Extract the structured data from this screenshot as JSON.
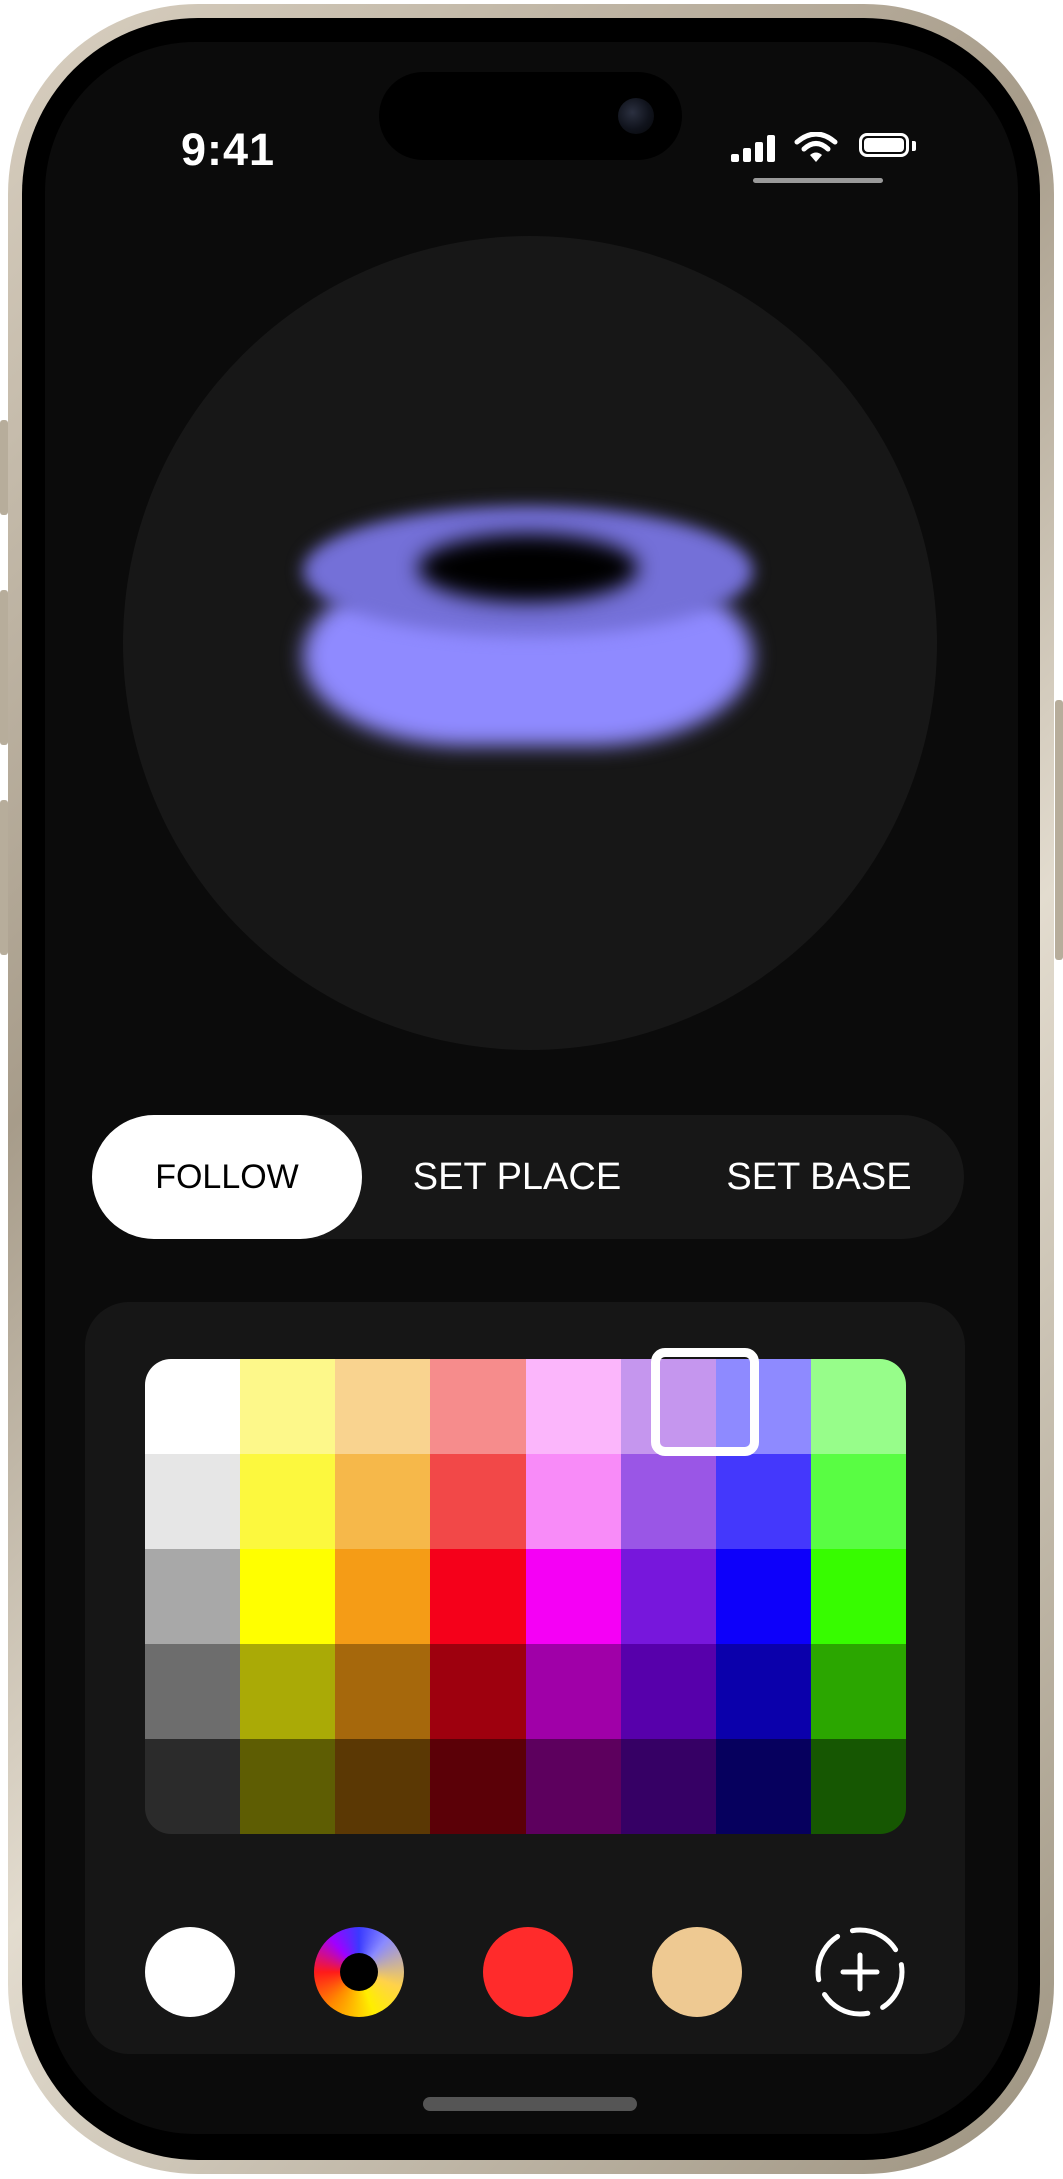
{
  "status_bar": {
    "time": "9:41"
  },
  "modes": {
    "items": [
      {
        "label": "FOLLOW",
        "active": true
      },
      {
        "label": "SET PLACE",
        "active": false
      },
      {
        "label": "SET BASE",
        "active": false
      }
    ]
  },
  "preview": {
    "ring_color": "#8f8aff"
  },
  "palette": {
    "selected": {
      "row": 0,
      "col": 6,
      "color": "#8e8aff"
    },
    "rows": [
      [
        "#ffffff",
        "#fdf88a",
        "#f9d38f",
        "#f68c8c",
        "#fbb6fb",
        "#c596ee",
        "#8e8aff",
        "#97fd8a"
      ],
      [
        "#e6e6e6",
        "#fcf83e",
        "#f6b84a",
        "#f24848",
        "#f88bf8",
        "#9a56e6",
        "#4438fc",
        "#59fd43"
      ],
      [
        "#a8a8a8",
        "#ffff00",
        "#f59c16",
        "#f5001a",
        "#f500f5",
        "#7717dc",
        "#0d00fa",
        "#37fc00"
      ],
      [
        "#6d6d6d",
        "#aaaa06",
        "#a6680c",
        "#9e000e",
        "#a000a8",
        "#5700ab",
        "#0b00ab",
        "#2ba600"
      ],
      [
        "#2b2b2b",
        "#5e5d03",
        "#5b3804",
        "#5b0007",
        "#5d005e",
        "#360065",
        "#06005e",
        "#165702"
      ]
    ]
  },
  "presets": [
    {
      "name": "white-swatch",
      "color": "#ffffff"
    },
    {
      "name": "color-wheel",
      "color": "multicolor"
    },
    {
      "name": "red-swatch",
      "color": "#ff2b2b"
    },
    {
      "name": "tan-swatch",
      "color": "#eec992"
    }
  ],
  "actions": {
    "add_icon": "add-color-icon"
  }
}
